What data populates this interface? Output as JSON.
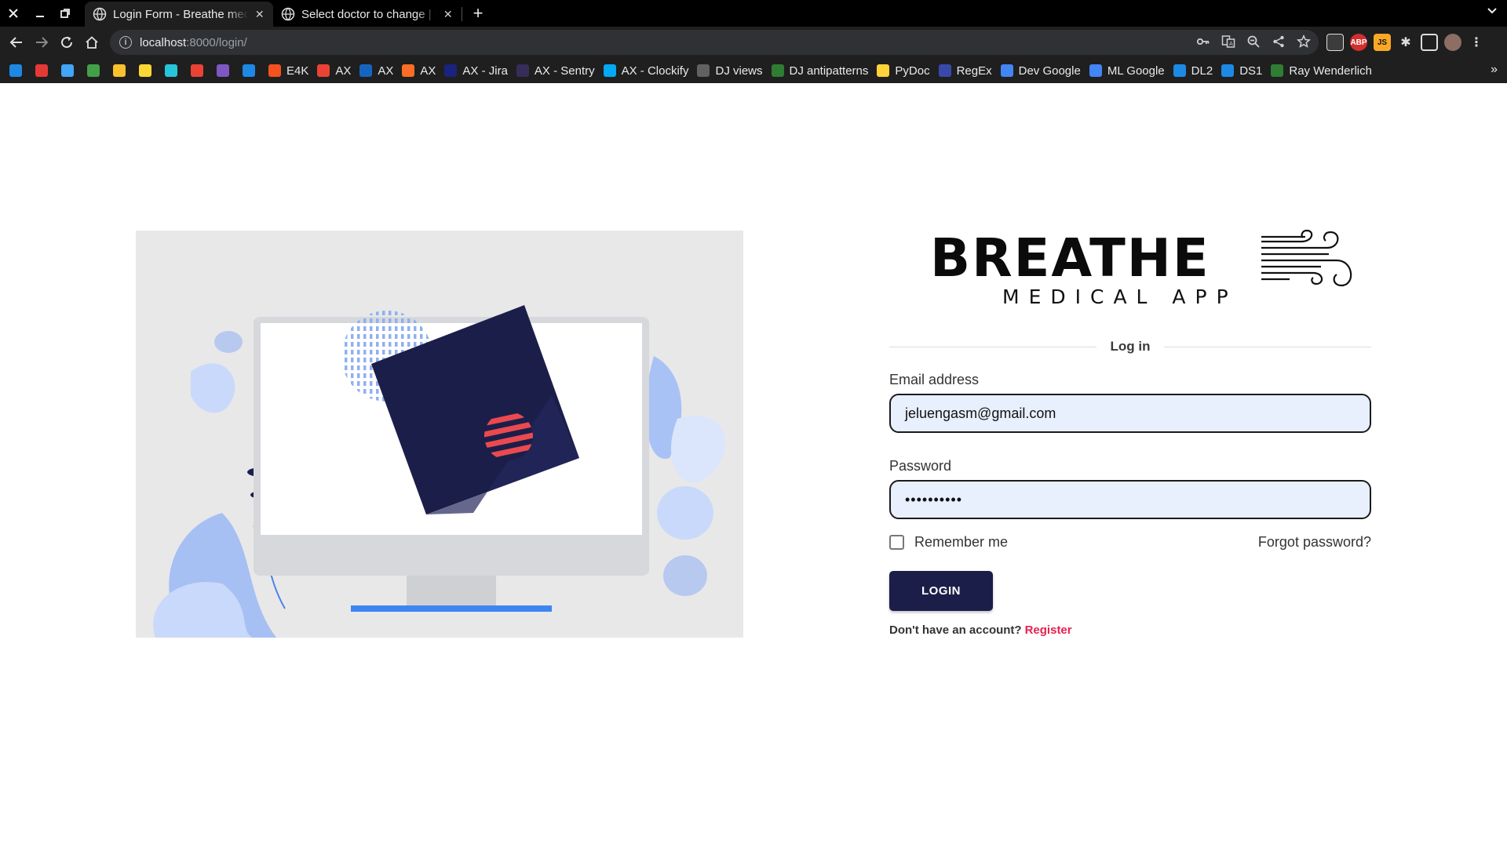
{
  "browser": {
    "tabs": [
      {
        "title": "Login Form - Breathe medical app",
        "active": true
      },
      {
        "title": "Select doctor to change | Django site admin",
        "active": false
      }
    ],
    "url_host": "localhost",
    "url_path": ":8000/login/",
    "bookmarks": [
      {
        "label": "",
        "color": "#1e88e5"
      },
      {
        "label": "",
        "color": "#e53935"
      },
      {
        "label": "",
        "color": "#42a5f5"
      },
      {
        "label": "",
        "color": "#43a047"
      },
      {
        "label": "",
        "color": "#fbc02d"
      },
      {
        "label": "",
        "color": "#fdd835"
      },
      {
        "label": "",
        "color": "#26c6da"
      },
      {
        "label": "",
        "color": "#ea4335"
      },
      {
        "label": "",
        "color": "#7e57c2"
      },
      {
        "label": "",
        "color": "#1e88e5"
      },
      {
        "label": "E4K",
        "color": "#f4511e"
      },
      {
        "label": "AX",
        "color": "#ea4335"
      },
      {
        "label": "AX",
        "color": "#1565c0"
      },
      {
        "label": "AX",
        "color": "#fc6d26"
      },
      {
        "label": "AX - Jira",
        "color": "#1a237e"
      },
      {
        "label": "AX - Sentry",
        "color": "#362d59"
      },
      {
        "label": "AX - Clockify",
        "color": "#03a9f4"
      },
      {
        "label": "DJ views",
        "color": "#616161"
      },
      {
        "label": "DJ antipatterns",
        "color": "#2e7d32"
      },
      {
        "label": "PyDoc",
        "color": "#ffd43b"
      },
      {
        "label": "RegEx",
        "color": "#3949ab"
      },
      {
        "label": "Dev Google",
        "color": "#4285f4"
      },
      {
        "label": "ML Google",
        "color": "#4285f4"
      },
      {
        "label": "DL2",
        "color": "#1e88e5"
      },
      {
        "label": "DS1",
        "color": "#1e88e5"
      },
      {
        "label": "Ray Wenderlich",
        "color": "#2e7d32"
      }
    ]
  },
  "login": {
    "logo_word": "BREATHE",
    "logo_sub": "MEDICAL APP",
    "section_title": "Log in",
    "email_label": "Email address",
    "email_value": "jeluengasm@gmail.com",
    "password_label": "Password",
    "password_value": "••••••••••",
    "remember_label": "Remember me",
    "remember_checked": false,
    "forgot_label": "Forgot password?",
    "login_button": "LOGIN",
    "no_account_text": "Don't have an account?",
    "register_label": "Register"
  },
  "colors": {
    "primary_button": "#1c1e4a",
    "register_link": "#e8204f",
    "input_fill": "#e8effd"
  }
}
